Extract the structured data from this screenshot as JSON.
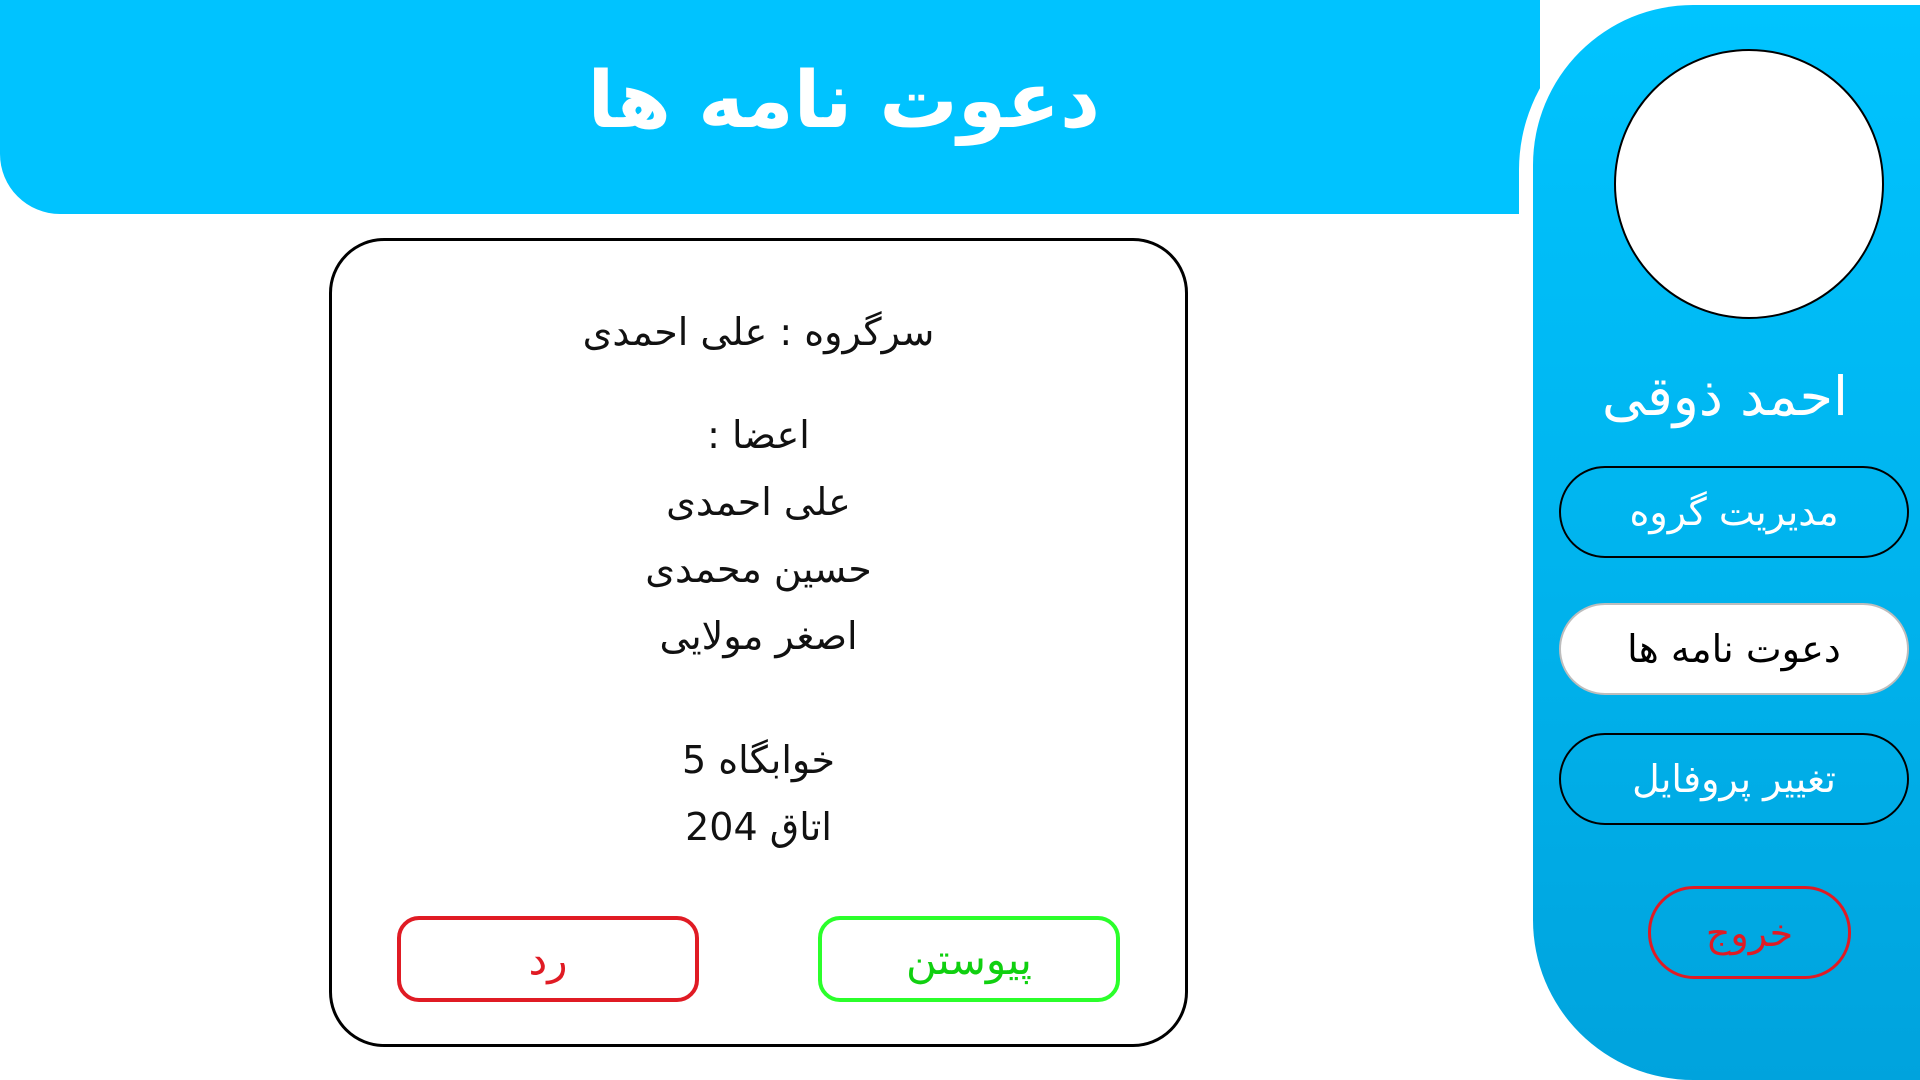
{
  "header": {
    "title": "دعوت نامه ها"
  },
  "sidebar": {
    "user_name": "احمد ذوقی",
    "items": [
      {
        "label": "مدیریت گروه",
        "active": false
      },
      {
        "label": "دعوت نامه ها",
        "active": true
      },
      {
        "label": "تغییر پروفایل",
        "active": false
      }
    ],
    "exit_label": "خروج"
  },
  "invitation": {
    "leader_line": "سرگروه : علی احمدی",
    "members_label": "اعضا :",
    "members": [
      "علی احمدی",
      "حسین محمدی",
      "اصغر مولایی"
    ],
    "dorm": "خوابگاه 5",
    "room": "اتاق 204",
    "join_label": "پیوستن",
    "reject_label": "رد"
  },
  "colors": {
    "accent": "#00c3ff",
    "join": "#2bff2b",
    "reject": "#e01b24"
  }
}
